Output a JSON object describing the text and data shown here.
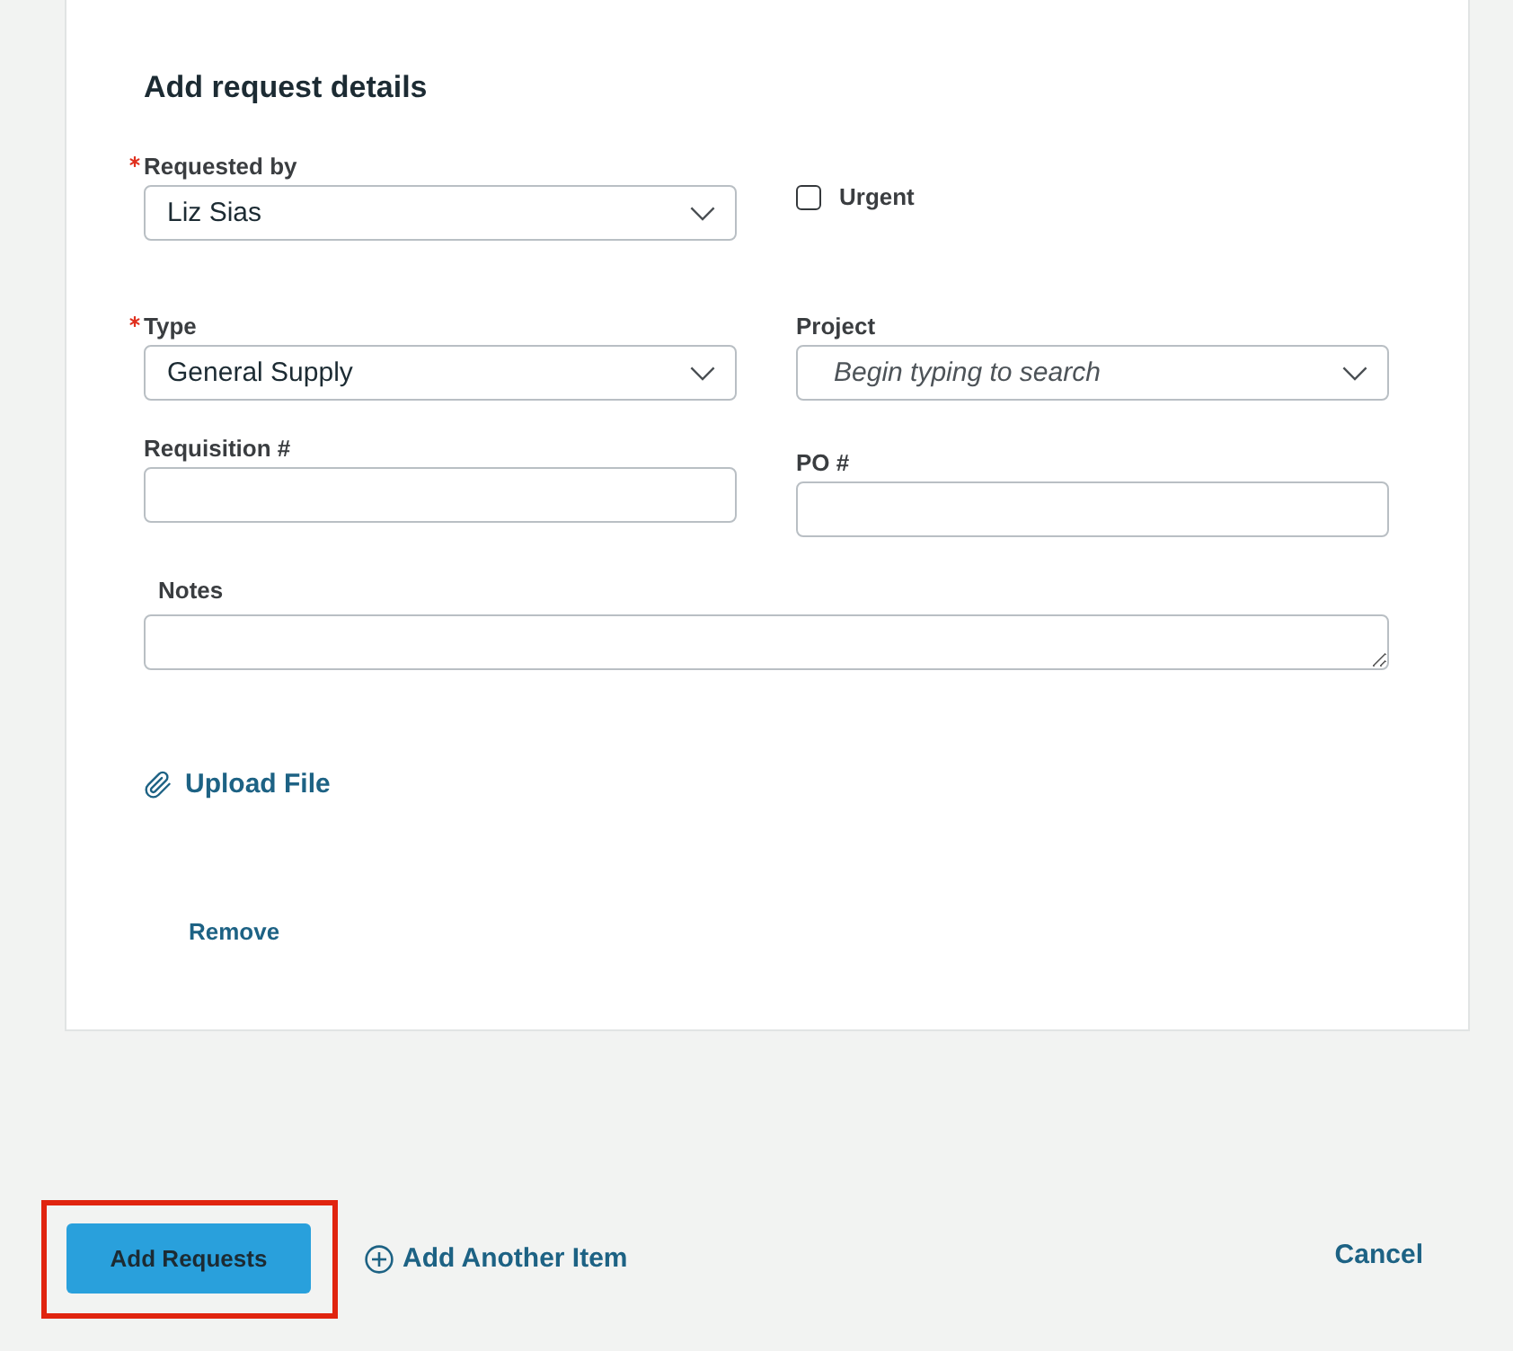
{
  "card": {
    "heading": "Add request details"
  },
  "requested_by": {
    "label": "Requested by",
    "required": true,
    "value": "Liz Sias"
  },
  "urgent": {
    "label": "Urgent",
    "checked": false
  },
  "type": {
    "label": "Type",
    "required": true,
    "value": "General Supply"
  },
  "project": {
    "label": "Project",
    "required": false,
    "placeholder": "Begin typing to search"
  },
  "requisition_number": {
    "label": "Requisition #",
    "required": false
  },
  "po_number": {
    "label": "PO #",
    "required": false
  },
  "notes": {
    "label": "Notes"
  },
  "upload_link": "Upload File",
  "remove_link": "Remove",
  "footer": {
    "submit_button": {
      "label": "Add Requests",
      "highlighted": true
    },
    "add_another_link": "Add Another Item",
    "cancel_link": "Cancel"
  }
}
